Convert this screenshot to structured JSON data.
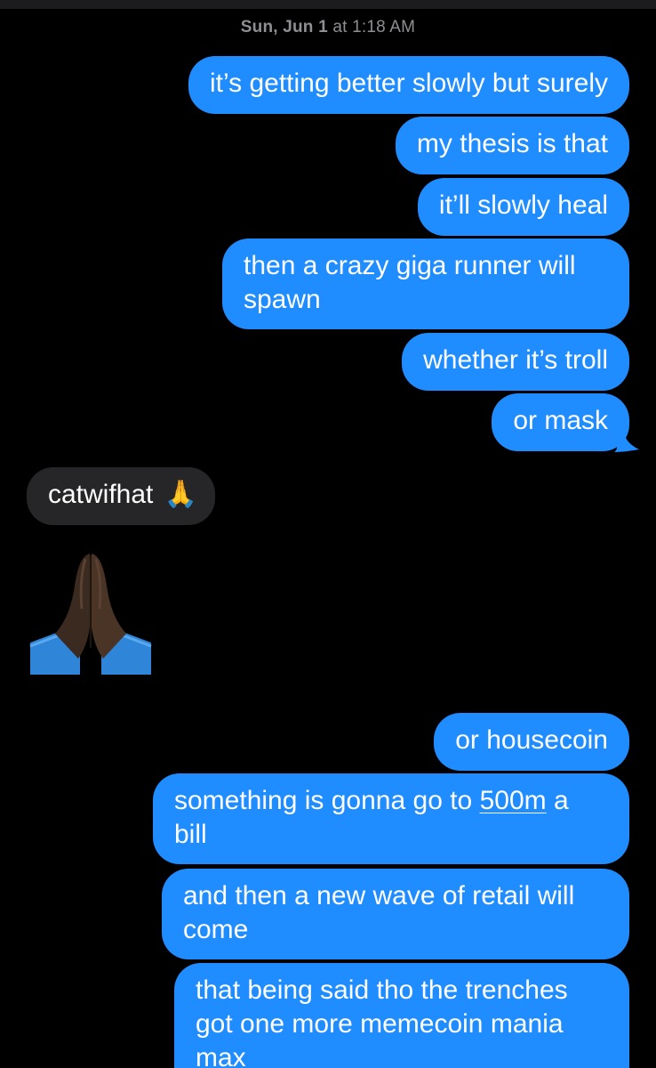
{
  "header": {
    "timestamp_day": "Sun, Jun 1",
    "timestamp_time": " at 1:18 AM"
  },
  "messages": [
    {
      "from": "me",
      "text": "it’s getting better slowly but surely"
    },
    {
      "from": "me",
      "text": "my thesis is that"
    },
    {
      "from": "me",
      "text": "it’ll slowly heal"
    },
    {
      "from": "me",
      "text": "then a crazy giga runner will spawn"
    },
    {
      "from": "me",
      "text": "whether it’s troll"
    },
    {
      "from": "me",
      "text": "or mask"
    },
    {
      "from": "them",
      "text": "catwifhat",
      "emoji": "🙏"
    },
    {
      "from": "them",
      "big_emoji": "praying-hands-dark-skin"
    },
    {
      "from": "me",
      "text": "or housecoin"
    },
    {
      "from": "me",
      "text_before_link": "something is gonna go to ",
      "link": "500m",
      "text_after_link": " a bill"
    },
    {
      "from": "me",
      "text": "and then a new wave of retail will come"
    },
    {
      "from": "me",
      "text": "that being said tho the trenches got one more memecoin mania max"
    }
  ],
  "colors": {
    "background": "#000000",
    "outgoing_bubble": "#1f8cff",
    "incoming_bubble": "#262628",
    "timestamp": "#8e8e93",
    "text": "#ffffff"
  }
}
